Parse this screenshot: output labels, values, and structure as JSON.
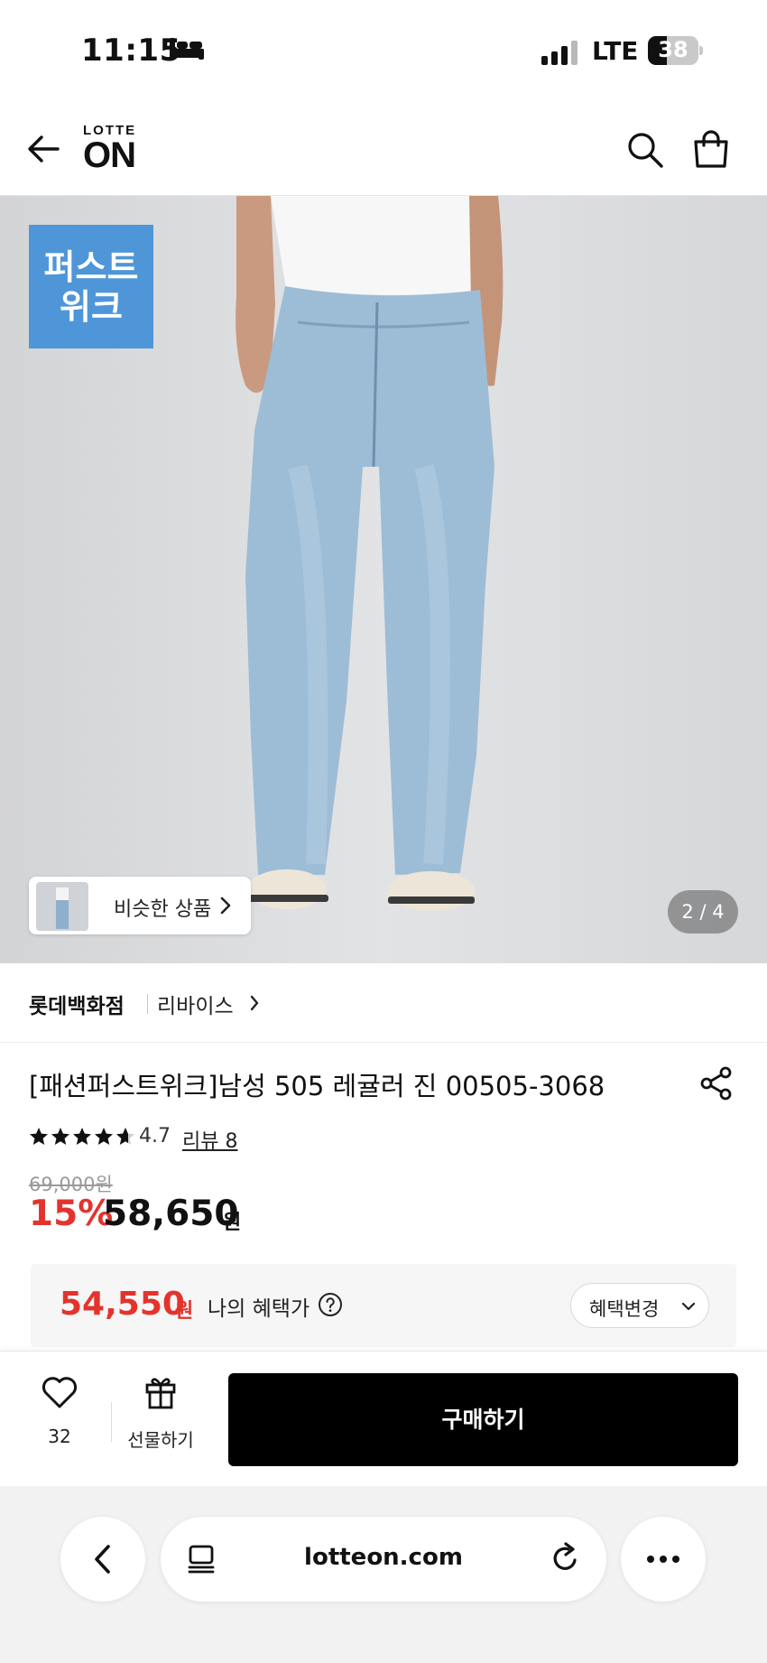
{
  "status_bar": {
    "time": "11:15",
    "network": "LTE",
    "battery": "38",
    "battery_level": 0.38,
    "icons": [
      "bed-icon",
      "signal-icon",
      "battery-icon"
    ]
  },
  "header": {
    "logo_top": "LOTTE",
    "logo_main": "ON",
    "icons": [
      "back-arrow-icon",
      "search-icon",
      "shopping-bag-icon"
    ]
  },
  "hero": {
    "badge": "퍼스트\n위크",
    "badge_color": "#4f96d8",
    "similar_label": "비슷한 상품",
    "page_indicator": "2 / 4"
  },
  "store": {
    "name": "롯데백화점",
    "brand": "리바이스"
  },
  "product": {
    "title": "[패션퍼스트위크]남성 505 레귤러 진 00505-3068",
    "rating": "4.7",
    "review_label": "리뷰 8",
    "original_price": "69,000원",
    "discount": "15%",
    "sale_price": "58,650",
    "currency": "원"
  },
  "benefit": {
    "price": "54,550",
    "currency": "원",
    "label": "나의 혜택가",
    "change_label": "혜택변경",
    "accent_color": "#e4332d"
  },
  "action_bar": {
    "like_count": "32",
    "gift_label": "선물하기",
    "buy_label": "구매하기"
  },
  "browser": {
    "url": "lotteon.com",
    "icons": [
      "chevron-left-icon",
      "reader-icon",
      "reload-icon",
      "more-icon"
    ]
  }
}
